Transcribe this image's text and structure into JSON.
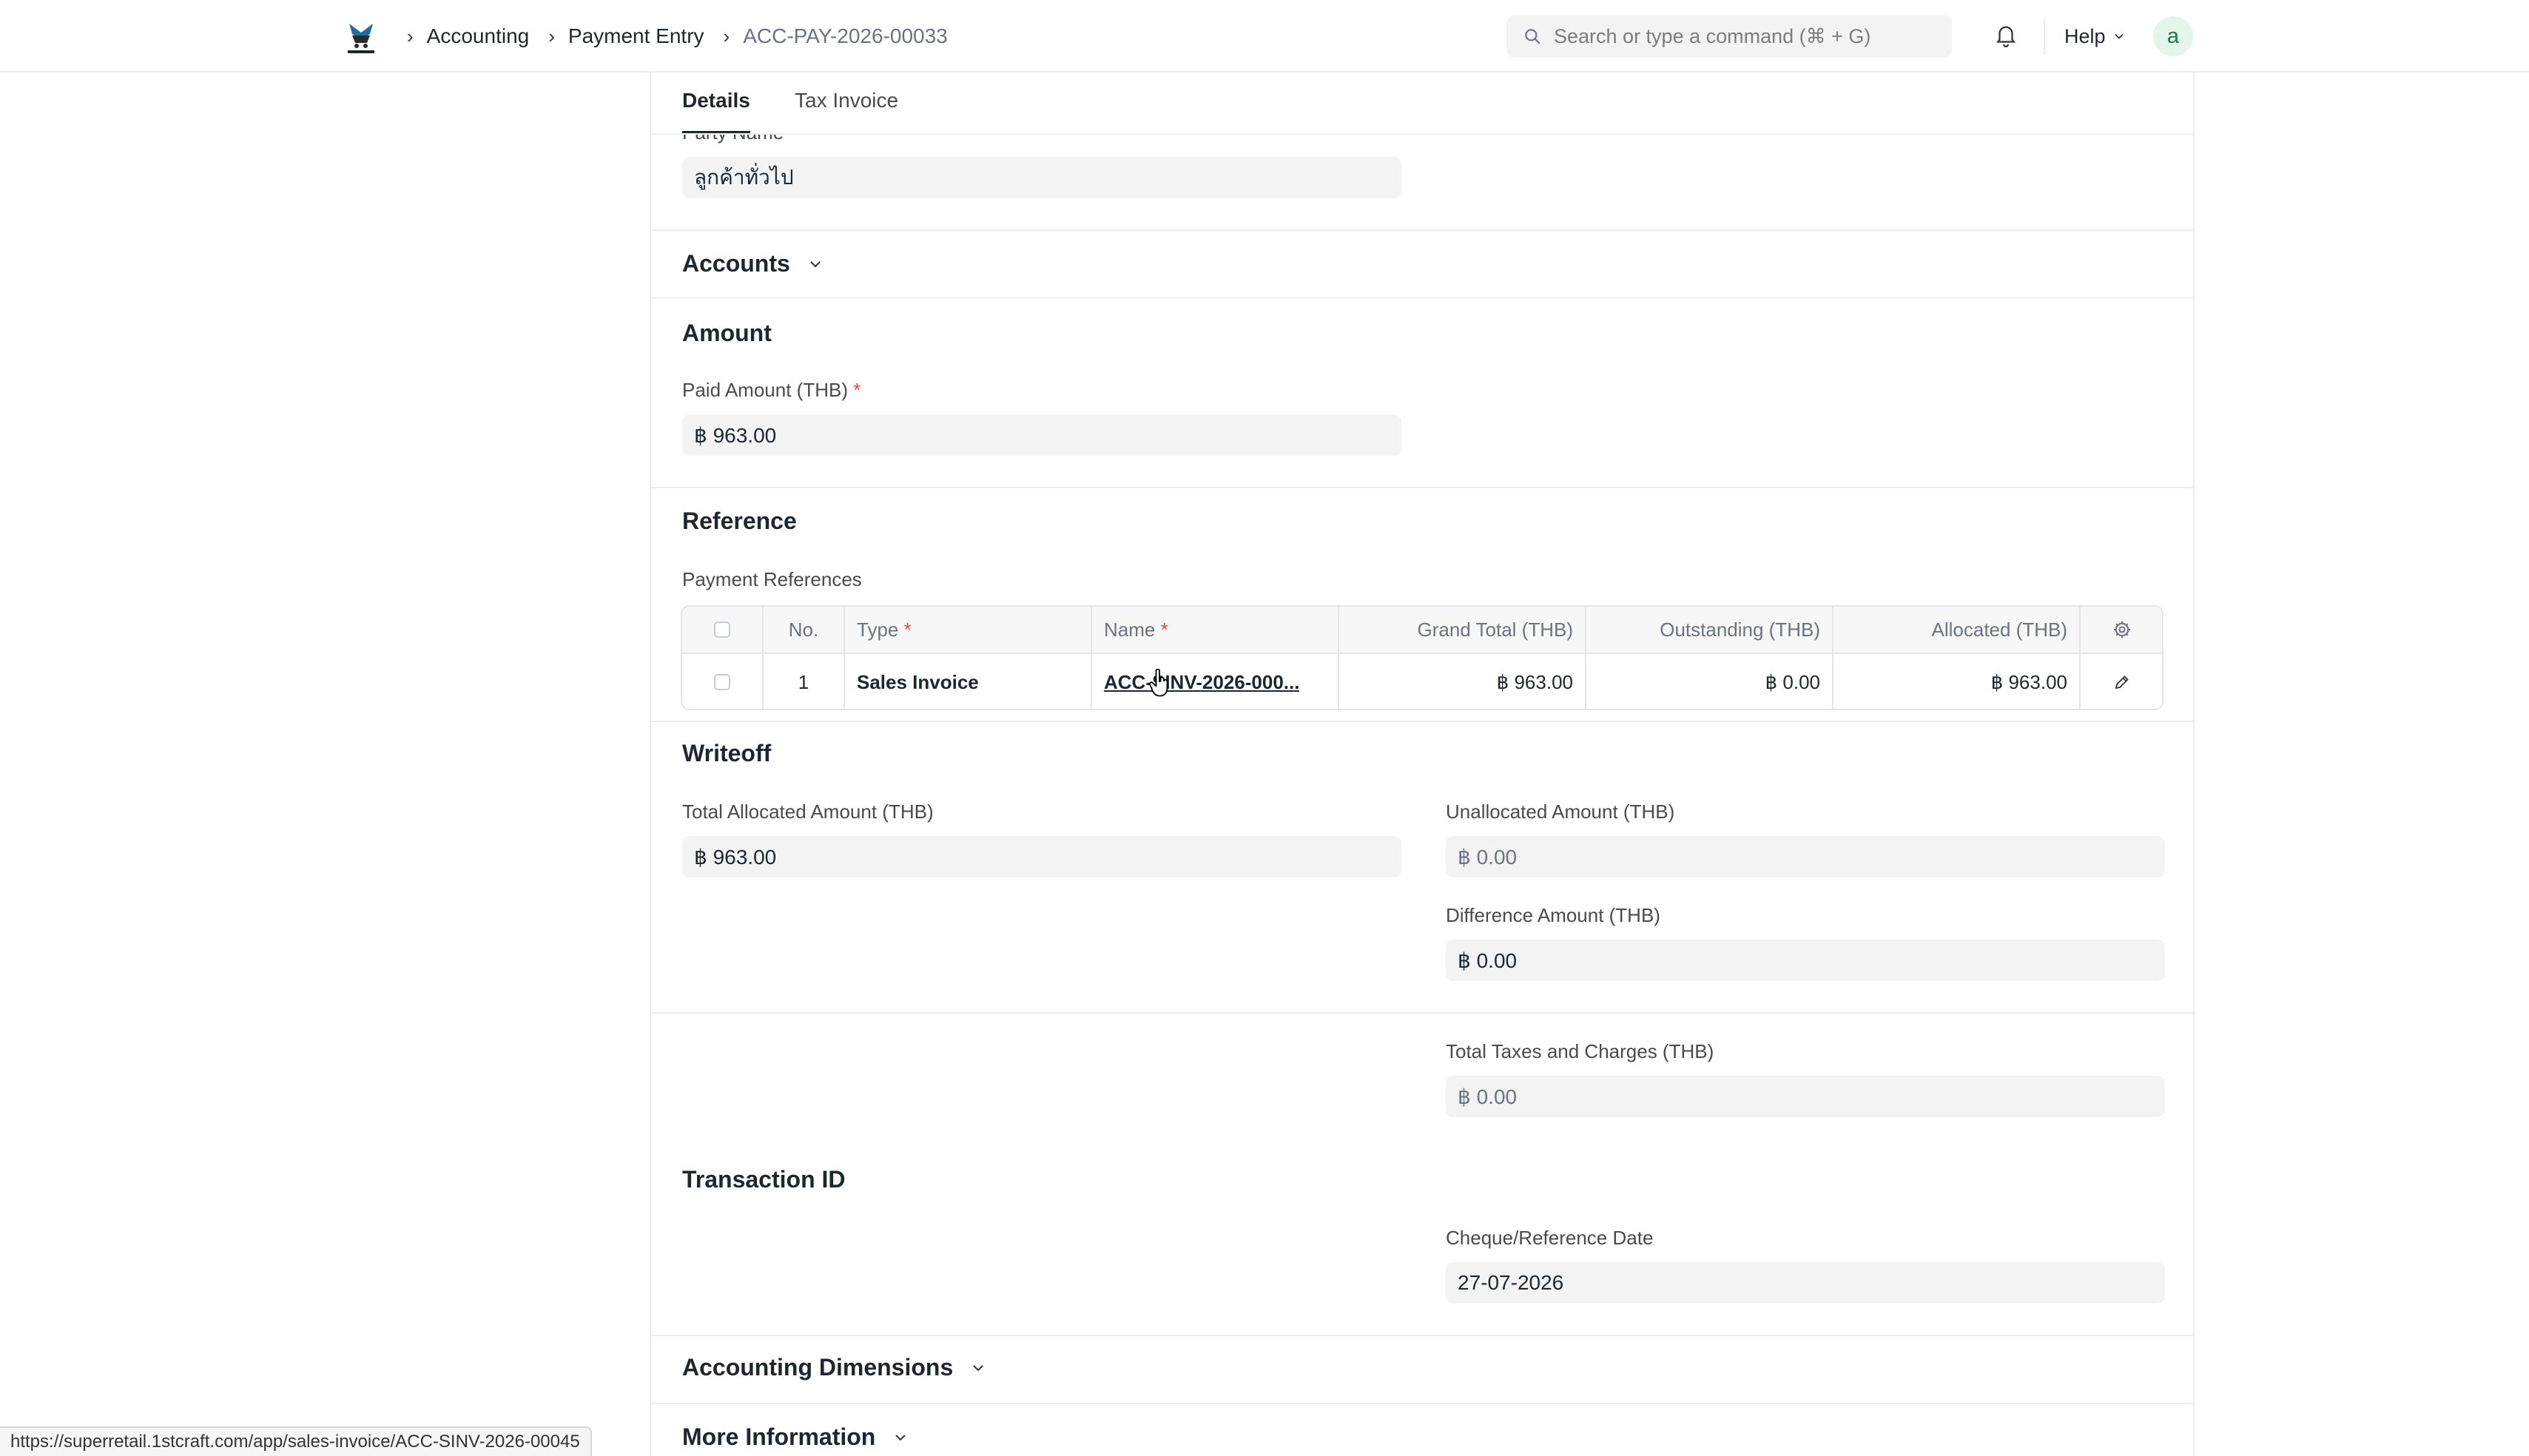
{
  "navbar": {
    "breadcrumbs": [
      "Accounting",
      "Payment Entry",
      "ACC-PAY-2026-00033"
    ],
    "search_placeholder": "Search or type a command (⌘ + G)",
    "help_label": "Help",
    "avatar_initial": "a"
  },
  "tabs": [
    {
      "label": "Details",
      "active": true
    },
    {
      "label": "Tax Invoice",
      "active": false
    }
  ],
  "party": {
    "label": "Party Name",
    "value": "ลูกค้าทั่วไป"
  },
  "sections": {
    "accounts": "Accounts",
    "amount": "Amount",
    "reference": "Reference",
    "writeoff": "Writeoff",
    "transaction_id": "Transaction ID",
    "accounting_dimensions": "Accounting Dimensions",
    "more_information": "More Information"
  },
  "amount": {
    "paid_label": "Paid Amount (THB)",
    "paid_value": "฿ 963.00"
  },
  "references": {
    "label": "Payment References",
    "columns": [
      "No.",
      "Type",
      "Name",
      "Grand Total (THB)",
      "Outstanding (THB)",
      "Allocated (THB)"
    ],
    "rows": [
      {
        "no": "1",
        "type": "Sales Invoice",
        "name": "ACC-SINV-2026-000...",
        "grand_total": "฿ 963.00",
        "outstanding": "฿ 0.00",
        "allocated": "฿ 963.00"
      }
    ]
  },
  "writeoff": {
    "total_allocated_label": "Total Allocated Amount (THB)",
    "total_allocated_value": "฿ 963.00",
    "unallocated_label": "Unallocated Amount (THB)",
    "unallocated_value": "฿ 0.00",
    "difference_label": "Difference Amount (THB)",
    "difference_value": "฿ 0.00"
  },
  "taxes": {
    "label": "Total Taxes and Charges (THB)",
    "value": "฿ 0.00"
  },
  "transaction": {
    "cheque_date_label": "Cheque/Reference Date",
    "cheque_date_value": "27-07-2026"
  },
  "status_url": "https://superretail.1stcraft.com/app/sales-invoice/ACC-SINV-2026-00045",
  "colors": {
    "field_bg": "#f3f3f3",
    "border": "#ebeef0",
    "required": "#e24c4c",
    "avatar_bg": "#e4f5e9",
    "avatar_fg": "#16794c"
  }
}
